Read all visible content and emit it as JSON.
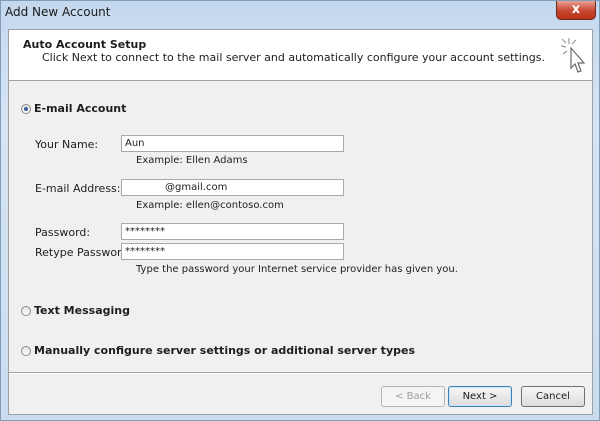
{
  "window": {
    "title": "Add New Account",
    "close_symbol": "x"
  },
  "header": {
    "title": "Auto Account Setup",
    "subtitle": "Click Next to connect to the mail server and automatically configure your account settings."
  },
  "options": {
    "email_account": {
      "label": "E-mail Account",
      "selected": true
    },
    "text_messaging": {
      "label": "Text Messaging",
      "selected": false
    },
    "manual": {
      "label": "Manually configure server settings or additional server types",
      "selected": false
    }
  },
  "form": {
    "name": {
      "label": "Your Name:",
      "value": "Aun",
      "example": "Example: Ellen Adams"
    },
    "email": {
      "label": "E-mail Address:",
      "value": "@gmail.com",
      "example": "Example: ellen@contoso.com"
    },
    "password": {
      "label": "Password:",
      "value": "********"
    },
    "retype": {
      "label": "Retype Password:",
      "value": "********"
    },
    "password_hint": "Type the password your Internet service provider has given you."
  },
  "buttons": {
    "back": "< Back",
    "next": "Next >",
    "cancel": "Cancel"
  },
  "icons": {
    "wizard": "cursor-sparkle-icon"
  }
}
